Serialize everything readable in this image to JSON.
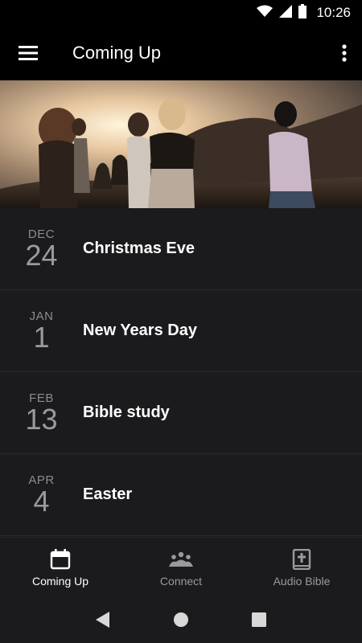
{
  "status_bar": {
    "time": "10:26"
  },
  "app_bar": {
    "title": "Coming Up"
  },
  "events": [
    {
      "month": "DEC",
      "day": "24",
      "name": "Christmas Eve"
    },
    {
      "month": "JAN",
      "day": "1",
      "name": "New Years Day"
    },
    {
      "month": "FEB",
      "day": "13",
      "name": "Bible study"
    },
    {
      "month": "APR",
      "day": "4",
      "name": "Easter"
    }
  ],
  "bottom_nav": {
    "items": [
      {
        "label": "Coming Up",
        "icon": "calendar-icon",
        "active": true
      },
      {
        "label": "Connect",
        "icon": "people-icon",
        "active": false
      },
      {
        "label": "Audio Bible",
        "icon": "bible-icon",
        "active": false
      }
    ]
  },
  "colors": {
    "background": "#1b1b1d",
    "bar": "#000000",
    "muted_text": "#8c8c90"
  }
}
